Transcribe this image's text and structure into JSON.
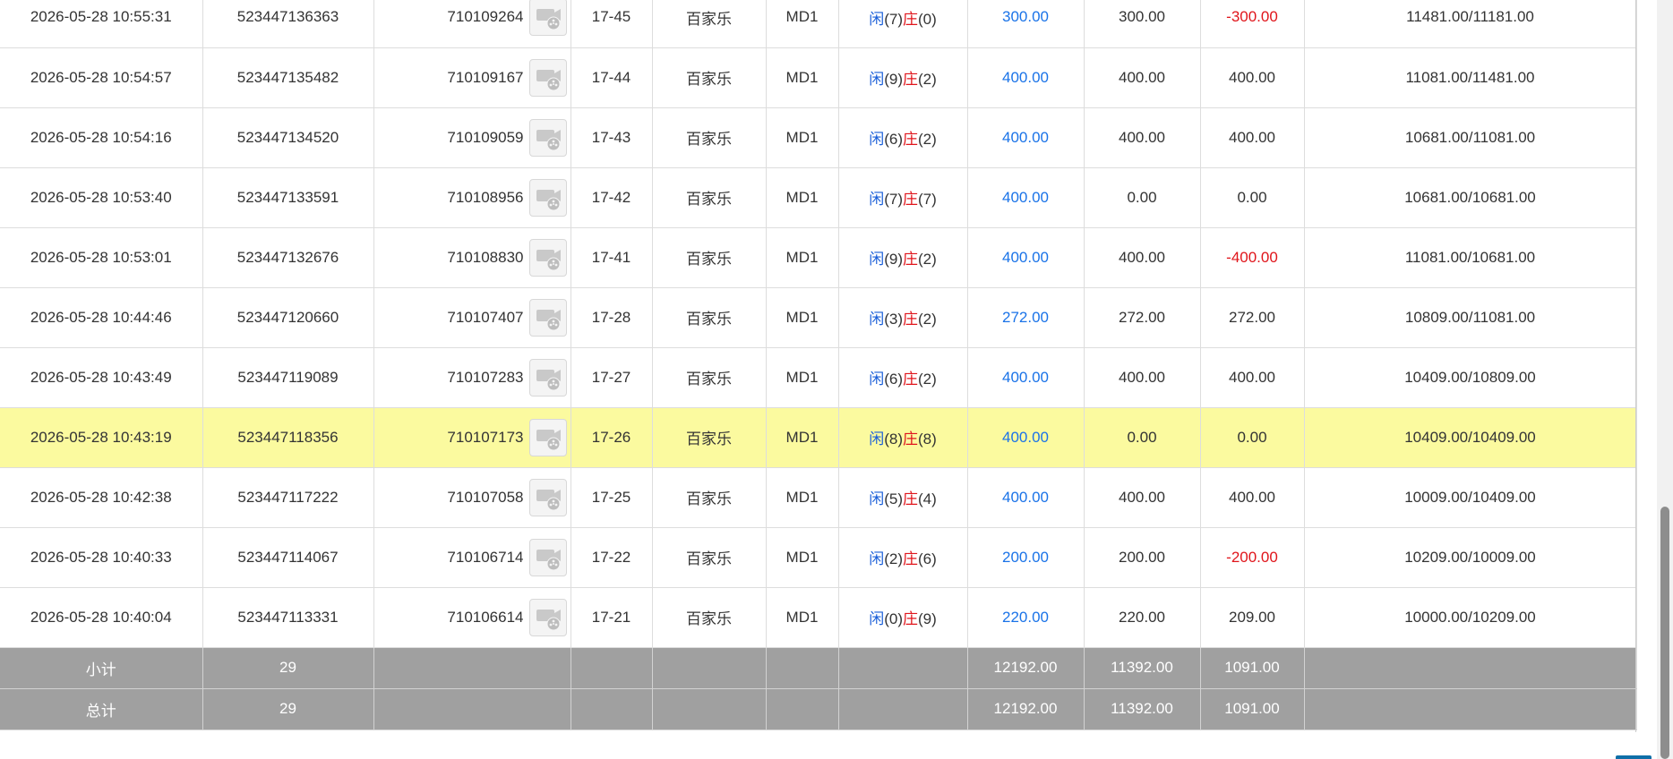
{
  "rows": [
    {
      "time": "2026-05-28 10:55:31",
      "order": "523447136363",
      "game_id": "710109264",
      "round": "17-45",
      "game": "百家乐",
      "table": "MD1",
      "player_label": "闲",
      "player_score": "(7)",
      "banker_label": "庄",
      "banker_score": "(0)",
      "bet": "300.00",
      "valid": "300.00",
      "win": "-300.00",
      "win_color": "red",
      "balance": "11481.00/11181.00",
      "highlight": false
    },
    {
      "time": "2026-05-28 10:54:57",
      "order": "523447135482",
      "game_id": "710109167",
      "round": "17-44",
      "game": "百家乐",
      "table": "MD1",
      "player_label": "闲",
      "player_score": "(9)",
      "banker_label": "庄",
      "banker_score": "(2)",
      "bet": "400.00",
      "valid": "400.00",
      "win": "400.00",
      "win_color": "normal",
      "balance": "11081.00/11481.00",
      "highlight": false
    },
    {
      "time": "2026-05-28 10:54:16",
      "order": "523447134520",
      "game_id": "710109059",
      "round": "17-43",
      "game": "百家乐",
      "table": "MD1",
      "player_label": "闲",
      "player_score": "(6)",
      "banker_label": "庄",
      "banker_score": "(2)",
      "bet": "400.00",
      "valid": "400.00",
      "win": "400.00",
      "win_color": "normal",
      "balance": "10681.00/11081.00",
      "highlight": false
    },
    {
      "time": "2026-05-28 10:53:40",
      "order": "523447133591",
      "game_id": "710108956",
      "round": "17-42",
      "game": "百家乐",
      "table": "MD1",
      "player_label": "闲",
      "player_score": "(7)",
      "banker_label": "庄",
      "banker_score": "(7)",
      "bet": "400.00",
      "valid": "0.00",
      "win": "0.00",
      "win_color": "normal",
      "balance": "10681.00/10681.00",
      "highlight": false
    },
    {
      "time": "2026-05-28 10:53:01",
      "order": "523447132676",
      "game_id": "710108830",
      "round": "17-41",
      "game": "百家乐",
      "table": "MD1",
      "player_label": "闲",
      "player_score": "(9)",
      "banker_label": "庄",
      "banker_score": "(2)",
      "bet": "400.00",
      "valid": "400.00",
      "win": "-400.00",
      "win_color": "red",
      "balance": "11081.00/10681.00",
      "highlight": false
    },
    {
      "time": "2026-05-28 10:44:46",
      "order": "523447120660",
      "game_id": "710107407",
      "round": "17-28",
      "game": "百家乐",
      "table": "MD1",
      "player_label": "闲",
      "player_score": "(3)",
      "banker_label": "庄",
      "banker_score": "(2)",
      "bet": "272.00",
      "valid": "272.00",
      "win": "272.00",
      "win_color": "normal",
      "balance": "10809.00/11081.00",
      "highlight": false
    },
    {
      "time": "2026-05-28 10:43:49",
      "order": "523447119089",
      "game_id": "710107283",
      "round": "17-27",
      "game": "百家乐",
      "table": "MD1",
      "player_label": "闲",
      "player_score": "(6)",
      "banker_label": "庄",
      "banker_score": "(2)",
      "bet": "400.00",
      "valid": "400.00",
      "win": "400.00",
      "win_color": "normal",
      "balance": "10409.00/10809.00",
      "highlight": false
    },
    {
      "time": "2026-05-28 10:43:19",
      "order": "523447118356",
      "game_id": "710107173",
      "round": "17-26",
      "game": "百家乐",
      "table": "MD1",
      "player_label": "闲",
      "player_score": "(8)",
      "banker_label": "庄",
      "banker_score": "(8)",
      "bet": "400.00",
      "valid": "0.00",
      "win": "0.00",
      "win_color": "normal",
      "balance": "10409.00/10409.00",
      "highlight": true
    },
    {
      "time": "2026-05-28 10:42:38",
      "order": "523447117222",
      "game_id": "710107058",
      "round": "17-25",
      "game": "百家乐",
      "table": "MD1",
      "player_label": "闲",
      "player_score": "(5)",
      "banker_label": "庄",
      "banker_score": "(4)",
      "bet": "400.00",
      "valid": "400.00",
      "win": "400.00",
      "win_color": "normal",
      "balance": "10009.00/10409.00",
      "highlight": false
    },
    {
      "time": "2026-05-28 10:40:33",
      "order": "523447114067",
      "game_id": "710106714",
      "round": "17-22",
      "game": "百家乐",
      "table": "MD1",
      "player_label": "闲",
      "player_score": "(2)",
      "banker_label": "庄",
      "banker_score": "(6)",
      "bet": "200.00",
      "valid": "200.00",
      "win": "-200.00",
      "win_color": "red",
      "balance": "10209.00/10009.00",
      "highlight": false
    },
    {
      "time": "2026-05-28 10:40:04",
      "order": "523447113331",
      "game_id": "710106614",
      "round": "17-21",
      "game": "百家乐",
      "table": "MD1",
      "player_label": "闲",
      "player_score": "(0)",
      "banker_label": "庄",
      "banker_score": "(9)",
      "bet": "220.00",
      "valid": "220.00",
      "win": "209.00",
      "win_color": "normal",
      "balance": "10000.00/10209.00",
      "highlight": false
    }
  ],
  "summary": [
    {
      "label": "小计",
      "count": "29",
      "bet": "12192.00",
      "valid": "11392.00",
      "win": "1091.00"
    },
    {
      "label": "总计",
      "count": "29",
      "bet": "12192.00",
      "valid": "11392.00",
      "win": "1091.00"
    }
  ],
  "icons": {
    "video": "video-reel-icon"
  },
  "colors": {
    "highlight_row": "#fbfa9f",
    "summary_bg": "#a0a0a0",
    "bet_blue": "#1a73e8",
    "loss_red": "#e0151b"
  }
}
